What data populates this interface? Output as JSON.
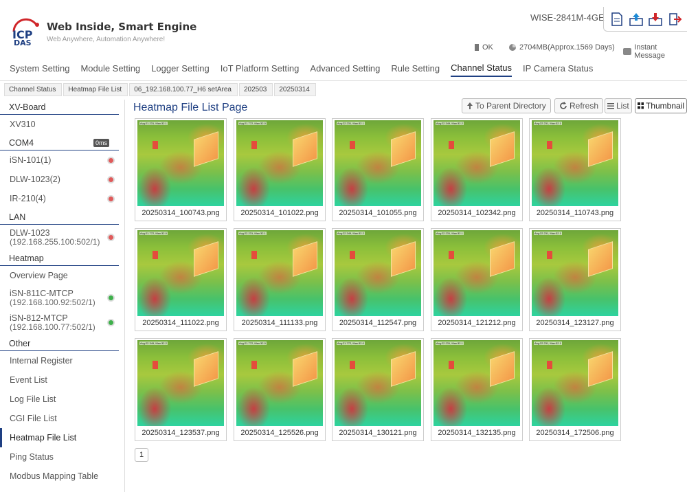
{
  "brand": {
    "logo_text": "ICP DAS",
    "title": "Web Inside, Smart Engine",
    "subtitle": "Web Anywhere, Automation Anywhere!"
  },
  "model": "WISE-2841M-4GE",
  "status": {
    "ok": "OK",
    "storage": "2704MB(Approx.1569 Days)",
    "message": "Instant Message"
  },
  "nav": [
    "System Setting",
    "Module Setting",
    "Logger Setting",
    "IoT Platform Setting",
    "Advanced Setting",
    "Rule Setting",
    "Channel Status",
    "IP Camera Status"
  ],
  "breadcrumb": [
    "Channel Status",
    "Heatmap File List",
    "06_192.168.100.77_H6 setArea",
    "202503",
    "20250314"
  ],
  "sidebar": {
    "items": [
      {
        "label": "XV-Board",
        "type": "section"
      },
      {
        "label": "XV310"
      },
      {
        "label": "COM4",
        "type": "section",
        "badge": "0ms"
      },
      {
        "label": "iSN-101(1)",
        "dot": "red"
      },
      {
        "label": "DLW-1023(2)",
        "dot": "red"
      },
      {
        "label": "IR-210(4)",
        "dot": "red"
      },
      {
        "label": "LAN",
        "type": "section"
      },
      {
        "label": "DLW-1023",
        "sub": "(192.168.255.100:502/1)",
        "dot": "red"
      },
      {
        "label": "Heatmap",
        "type": "section"
      },
      {
        "label": "Overview Page"
      },
      {
        "label": "iSN-811C-MTCP",
        "sub": "(192.168.100.92:502/1)",
        "dot": "green"
      },
      {
        "label": "iSN-812-MTCP",
        "sub": "(192.168.100.77:502/1)",
        "dot": "green"
      },
      {
        "label": "Other",
        "type": "section"
      },
      {
        "label": "Internal Register"
      },
      {
        "label": "Event List"
      },
      {
        "label": "Log File List"
      },
      {
        "label": "CGI File List"
      },
      {
        "label": "Heatmap File List",
        "current": true
      },
      {
        "label": "Ping Status"
      },
      {
        "label": "Modbus Mapping Table"
      }
    ]
  },
  "main": {
    "title": "Heatmap File List Page",
    "to_parent": "To Parent Directory",
    "refresh": "Refresh",
    "list": "List",
    "thumbnail": "Thumbnail",
    "files": [
      {
        "name": "20250314_100743.png",
        "hdr": "Avg:21.231, Max:32.1"
      },
      {
        "name": "20250314_101022.png",
        "hdr": "Avg:21.772, Max:32.0"
      },
      {
        "name": "20250314_101055.png",
        "hdr": "Avg:22.231, Max:32.1"
      },
      {
        "name": "20250314_102342.png",
        "hdr": "Avg:22.349, Max:32.2"
      },
      {
        "name": "20250314_110743.png",
        "hdr": "Avg:22.231, Max:32.1"
      },
      {
        "name": "20250314_111022.png",
        "hdr": "Avg:21.772, Max:32.0"
      },
      {
        "name": "20250314_111133.png",
        "hdr": "Avg:22.231, Max:32.1"
      },
      {
        "name": "20250314_112547.png",
        "hdr": "Avg:22.349, Max:32.2"
      },
      {
        "name": "20250314_121212.png",
        "hdr": "Avg:22.231, Max:32.1"
      },
      {
        "name": "20250314_123127.png",
        "hdr": "Avg:22.231, Max:32.1"
      },
      {
        "name": "20250314_123537.png",
        "hdr": "Avg:22.349, Max:32.2"
      },
      {
        "name": "20250314_125526.png",
        "hdr": "Avg:21.772, Max:32.0"
      },
      {
        "name": "20250314_130121.png",
        "hdr": "Avg:21.772, Max:32.0"
      },
      {
        "name": "20250314_132135.png",
        "hdr": "Avg:22.231, Max:32.1"
      },
      {
        "name": "20250314_172506.png",
        "hdr": "Avg:22.231, Max:32.1"
      }
    ],
    "page": "1"
  },
  "colors": {
    "accent": "#1e3f82",
    "logo_red": "#d0262a"
  },
  "icons": [
    "file-icon",
    "upload-icon",
    "download-icon",
    "logout-icon",
    "ok-icon",
    "storage-icon",
    "message-icon",
    "up-arrow-icon",
    "refresh-icon",
    "list-icon",
    "thumbnail-icon"
  ]
}
